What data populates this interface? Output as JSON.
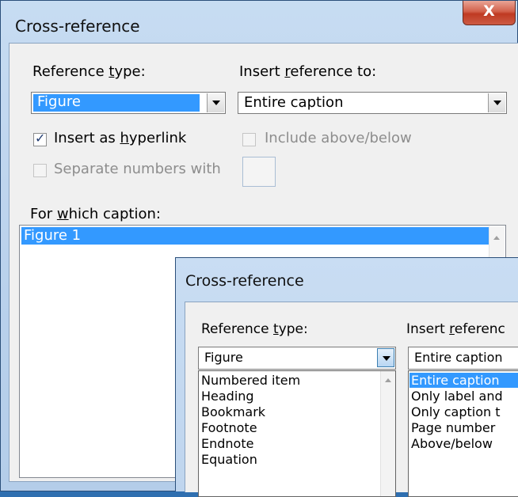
{
  "back_dialog": {
    "title": "Cross-reference",
    "close_glyph": "X",
    "reference_type_label_pre": "Reference ",
    "reference_type_label_u": "t",
    "reference_type_label_post": "ype:",
    "reference_type_value": "Figure",
    "insert_reference_label_pre": "Insert ",
    "insert_reference_label_u": "r",
    "insert_reference_label_post": "eference to:",
    "insert_reference_value": "Entire caption",
    "insert_hyperlink_pre": "Insert as ",
    "insert_hyperlink_u": "h",
    "insert_hyperlink_post": "yperlink",
    "insert_hyperlink_checked": true,
    "include_above_below": "Include above/below",
    "separate_numbers": "Separate numbers with",
    "for_which_caption_pre": "For ",
    "for_which_caption_u": "w",
    "for_which_caption_post": "hich caption:",
    "captions": [
      "Figure 1"
    ]
  },
  "front_dialog": {
    "title": "Cross-reference",
    "reference_type_label_pre": "Reference ",
    "reference_type_label_u": "t",
    "reference_type_label_post": "ype:",
    "insert_reference_label_pre": "Insert ",
    "insert_reference_label_u": "r",
    "insert_reference_label_post": "eferenc",
    "reference_type_value": "Figure",
    "insert_reference_value": "Entire caption",
    "reference_type_options": [
      "Numbered item",
      "Heading",
      "Bookmark",
      "Footnote",
      "Endnote",
      "Equation"
    ],
    "insert_reference_options": [
      "Entire caption",
      "Only label and",
      "Only caption t",
      "Page number",
      "Above/below"
    ],
    "insert_reference_selected_index": 0
  },
  "colors": {
    "selection": "#3399ff",
    "close_button": "#c9452c"
  }
}
